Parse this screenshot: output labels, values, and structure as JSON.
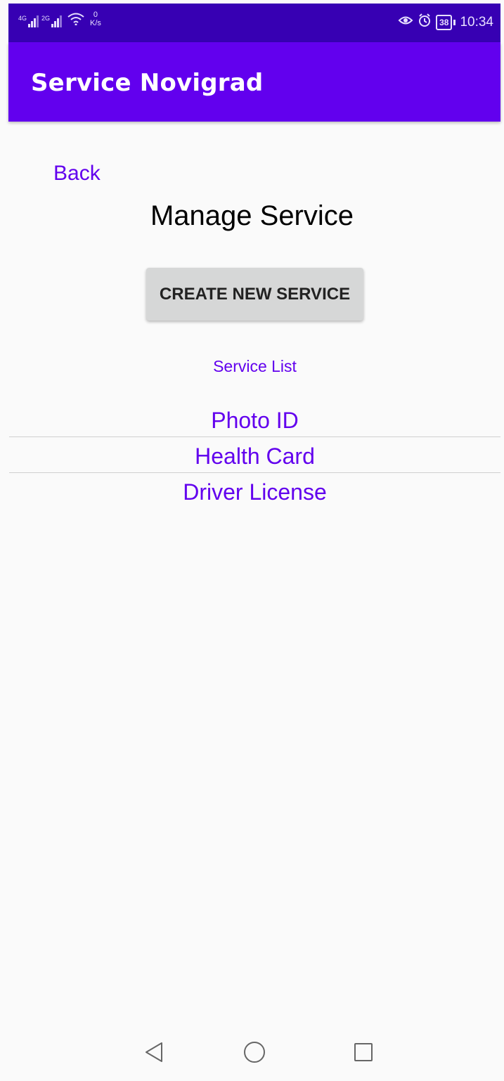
{
  "status_bar": {
    "sim1_label": "4G",
    "sim2_label": "2G",
    "speed_value": "0",
    "speed_unit": "K/s",
    "battery_level": "38",
    "time": "10:34",
    "icons": [
      "signal-icon",
      "wifi-icon",
      "eye-comfort-icon",
      "alarm-icon",
      "battery-icon"
    ]
  },
  "app_bar": {
    "title": "Service Novigrad",
    "color": "#6200ee"
  },
  "main": {
    "back_label": "Back",
    "page_title": "Manage Service",
    "create_button_label": "CREATE NEW SERVICE",
    "list_header": "Service List",
    "services": [
      {
        "label": "Photo ID"
      },
      {
        "label": "Health Card"
      },
      {
        "label": "Driver License"
      }
    ]
  },
  "nav_bar": {
    "buttons": [
      "back-nav-icon",
      "home-nav-icon",
      "recents-nav-icon"
    ]
  },
  "colors": {
    "status_bar": "#3700b3",
    "accent": "#6200ee",
    "background": "#fafafa",
    "button": "#d6d7d7"
  }
}
